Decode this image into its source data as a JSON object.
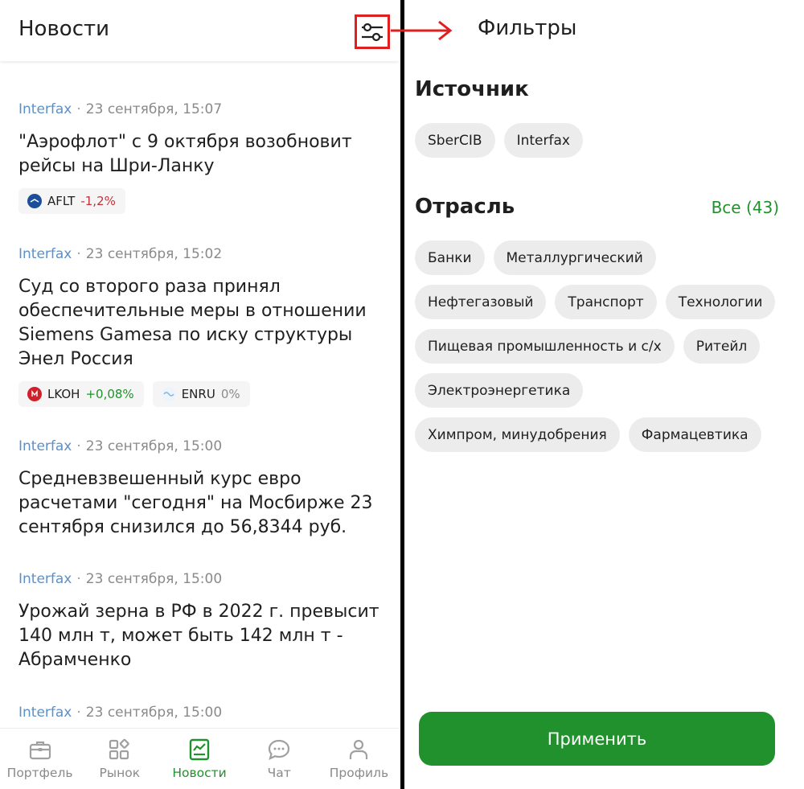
{
  "news_screen": {
    "title": "Новости",
    "items": [
      {
        "source": "Interfax",
        "time": "23 сентября, 15:07",
        "headline": "\"Аэрофлот\" с 9 октября возобновит рейсы на Шри-Ланку",
        "tickers": [
          {
            "symbol": "AFLT",
            "change": "-1,2%",
            "trend": "neg",
            "logo_color": "#1b4f9c"
          }
        ]
      },
      {
        "source": "Interfax",
        "time": "23 сентября, 15:02",
        "headline": "Суд со второго раза принял обеспечительные меры в отношении Siemens Gamesa по иску структуры Энел Россия",
        "tickers": [
          {
            "symbol": "LKOH",
            "change": "+0,08%",
            "trend": "pos",
            "logo_color": "#d0202a"
          },
          {
            "symbol": "ENRU",
            "change": "0%",
            "trend": "zero",
            "logo_color": "#7fb3e0"
          }
        ]
      },
      {
        "source": "Interfax",
        "time": "23 сентября, 15:00",
        "headline": "Средневзвешенный курс евро расчетами \"сегодня\" на Мосбирже 23 сентября снизился до 56,8344 руб.",
        "tickers": []
      },
      {
        "source": "Interfax",
        "time": "23 сентября, 15:00",
        "headline": "Урожай зерна в РФ в 2022 г. превысит 140 млн т, может быть 142 млн т - Абрамченко",
        "tickers": []
      },
      {
        "source": "Interfax",
        "time": "23 сентября, 15:00",
        "headline": "",
        "tickers": []
      }
    ],
    "nav": [
      {
        "label": "Портфель",
        "icon": "briefcase-icon",
        "active": false
      },
      {
        "label": "Рынок",
        "icon": "market-grid-icon",
        "active": false
      },
      {
        "label": "Новости",
        "icon": "news-chart-icon",
        "active": true
      },
      {
        "label": "Чат",
        "icon": "chat-icon",
        "active": false
      },
      {
        "label": "Профиль",
        "icon": "profile-icon",
        "active": false
      }
    ]
  },
  "filters_screen": {
    "title": "Фильтры",
    "source_heading": "Источник",
    "sources": [
      "SberCIB",
      "Interfax"
    ],
    "industry_heading": "Отрасль",
    "all_link": "Все (43)",
    "industries": [
      "Банки",
      "Металлургический",
      "Нефтегазовый",
      "Транспорт",
      "Технологии",
      "Пищевая промышленность и с/х",
      "Ритейл",
      "Электроэнергетика",
      "Химпром, минудобрения",
      "Фармацевтика"
    ],
    "apply_label": "Применить"
  },
  "colors": {
    "accent_green": "#21912d",
    "source_blue": "#5d8fc6",
    "negative_red": "#c2323b",
    "annotation_red": "#e02020"
  }
}
